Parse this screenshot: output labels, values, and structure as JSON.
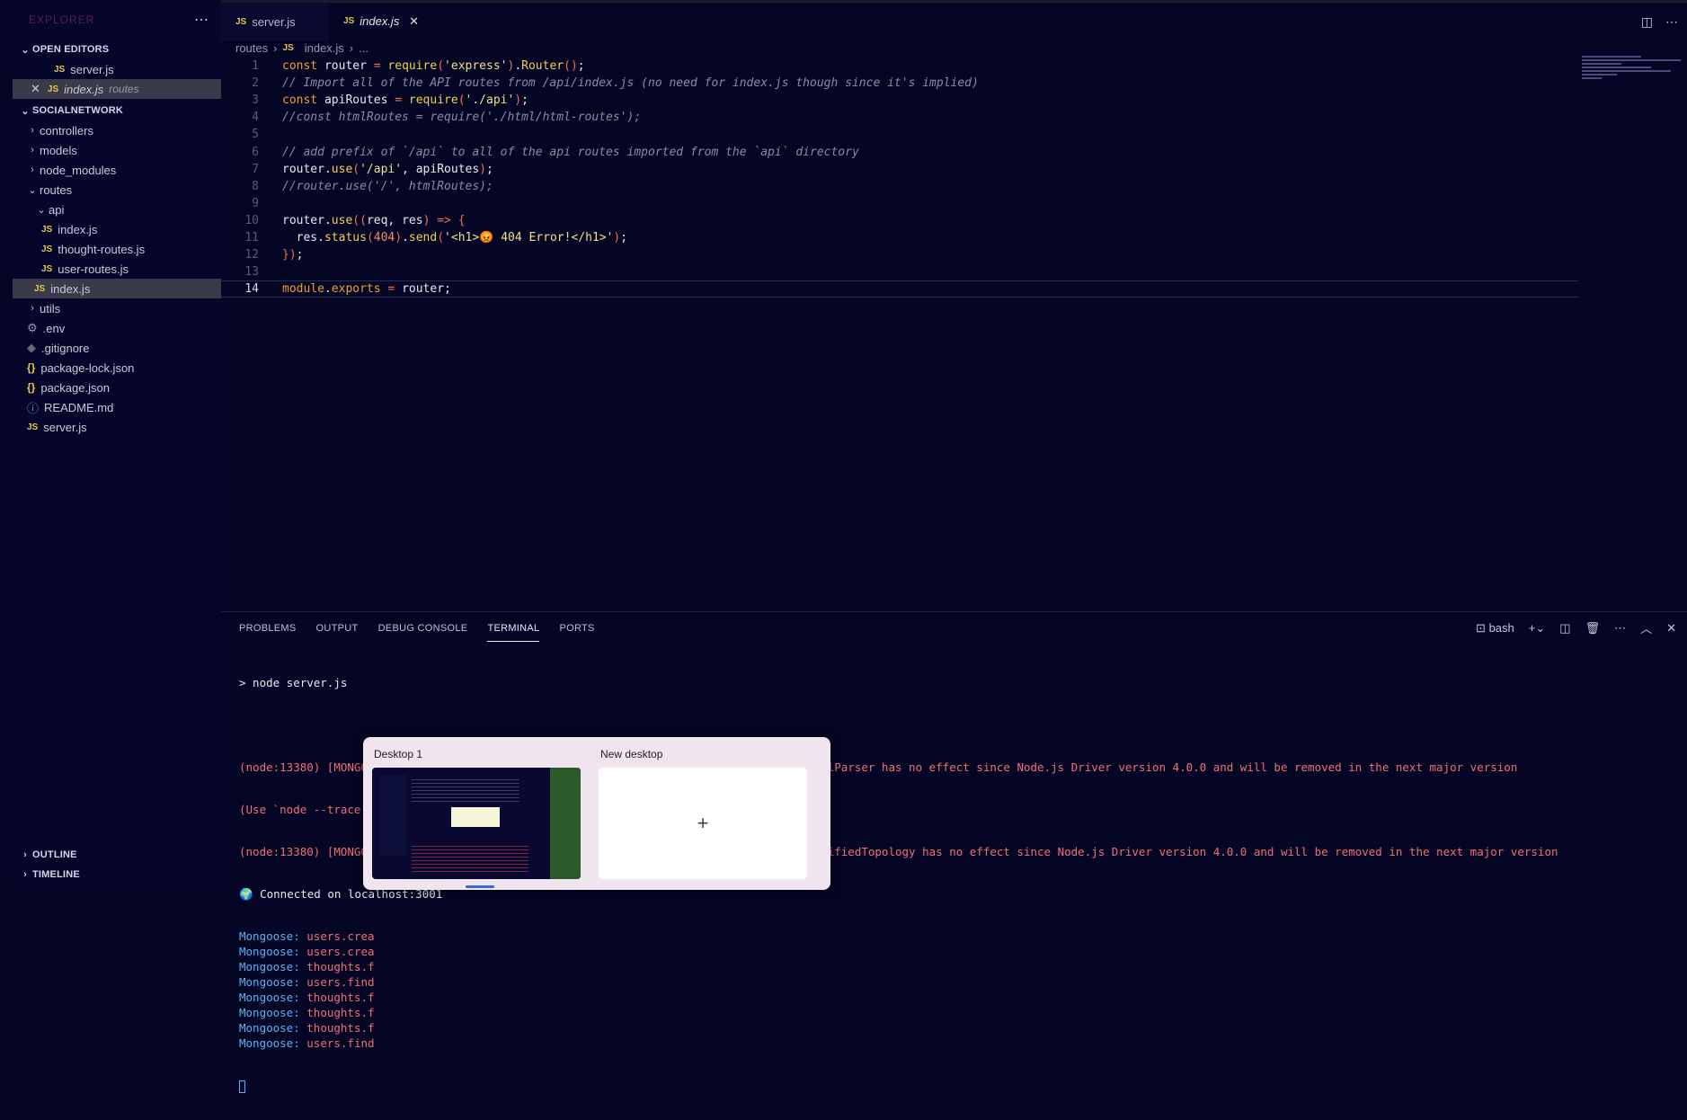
{
  "sidebar": {
    "explorer_title": "EXPLORER",
    "more_icon": "ellipsis-icon",
    "open_editors": {
      "header": "OPEN EDITORS",
      "items": [
        {
          "name": "server.js",
          "desc": ""
        },
        {
          "name": "index.js",
          "desc": "routes"
        }
      ]
    },
    "project": {
      "header": "SOCIALNETWORK",
      "tree": [
        {
          "label": "controllers",
          "type": "folder",
          "open": false
        },
        {
          "label": "models",
          "type": "folder",
          "open": false
        },
        {
          "label": "node_modules",
          "type": "folder",
          "open": false
        },
        {
          "label": "routes",
          "type": "folder",
          "open": true
        },
        {
          "label": "api",
          "type": "folder",
          "open": true
        },
        {
          "label": "index.js",
          "type": "js"
        },
        {
          "label": "thought-routes.js",
          "type": "js"
        },
        {
          "label": "user-routes.js",
          "type": "js"
        },
        {
          "label": "index.js",
          "type": "js"
        },
        {
          "label": "utils",
          "type": "folder",
          "open": false
        },
        {
          "label": ".env",
          "type": "env"
        },
        {
          "label": ".gitignore",
          "type": "git"
        },
        {
          "label": "package-lock.json",
          "type": "json"
        },
        {
          "label": "package.json",
          "type": "json"
        },
        {
          "label": "README.md",
          "type": "info"
        },
        {
          "label": "server.js",
          "type": "js"
        }
      ]
    },
    "outline": "OUTLINE",
    "timeline": "TIMELINE"
  },
  "tabs": [
    {
      "label": "server.js",
      "active": false
    },
    {
      "label": "index.js",
      "active": true
    }
  ],
  "breadcrumb": {
    "folder": "routes",
    "file": "index.js",
    "rest": "..."
  },
  "editor": {
    "current_line": 14,
    "lines": [
      "const router = require('express').Router();",
      "// Import all of the API routes from /api/index.js (no need for index.js though since it's implied)",
      "const apiRoutes = require('./api');",
      "//const htmlRoutes = require('./html/html-routes');",
      "",
      "// add prefix of `/api` to all of the api routes imported from the `api` directory",
      "router.use('/api', apiRoutes);",
      "//router.use('/', htmlRoutes);",
      "",
      "router.use((req, res) => {",
      "  res.status(404).send('<h1>😡 404 Error!</h1>');",
      "});",
      "",
      "module.exports = router;"
    ]
  },
  "panel": {
    "tabs": [
      "PROBLEMS",
      "OUTPUT",
      "DEBUG CONSOLE",
      "TERMINAL",
      "PORTS"
    ],
    "active_tab": "TERMINAL",
    "shell": "bash",
    "terminal": {
      "prompt": "> node server.js",
      "warn1": "(node:13380) [MONGODB DRIVER] Warning: useNewUrlParser is a deprecated option: useNewUrlParser has no effect since Node.js Driver version 4.0.0 and will be removed in the next major version",
      "warn2": "(Use `node --trace-warnings ...` to show where the warning was created)",
      "warn3": "(node:13380) [MONGODB DRIVER] Warning: useUnifiedTopology is a deprecated option: useUnifiedTopology has no effect since Node.js Driver version 4.0.0 and will be removed in the next major version",
      "connected": "🌍 Connected on localhost:3001",
      "mongoose_prefix": "Mongoose:",
      "mongoose_lines": [
        "users.crea",
        "users.crea",
        "thoughts.f",
        "users.find",
        "thoughts.f",
        "thoughts.f",
        "thoughts.f",
        "users.find"
      ]
    }
  },
  "taskview": {
    "desktop1": "Desktop 1",
    "new_desktop": "New desktop",
    "add_glyph": "+"
  }
}
